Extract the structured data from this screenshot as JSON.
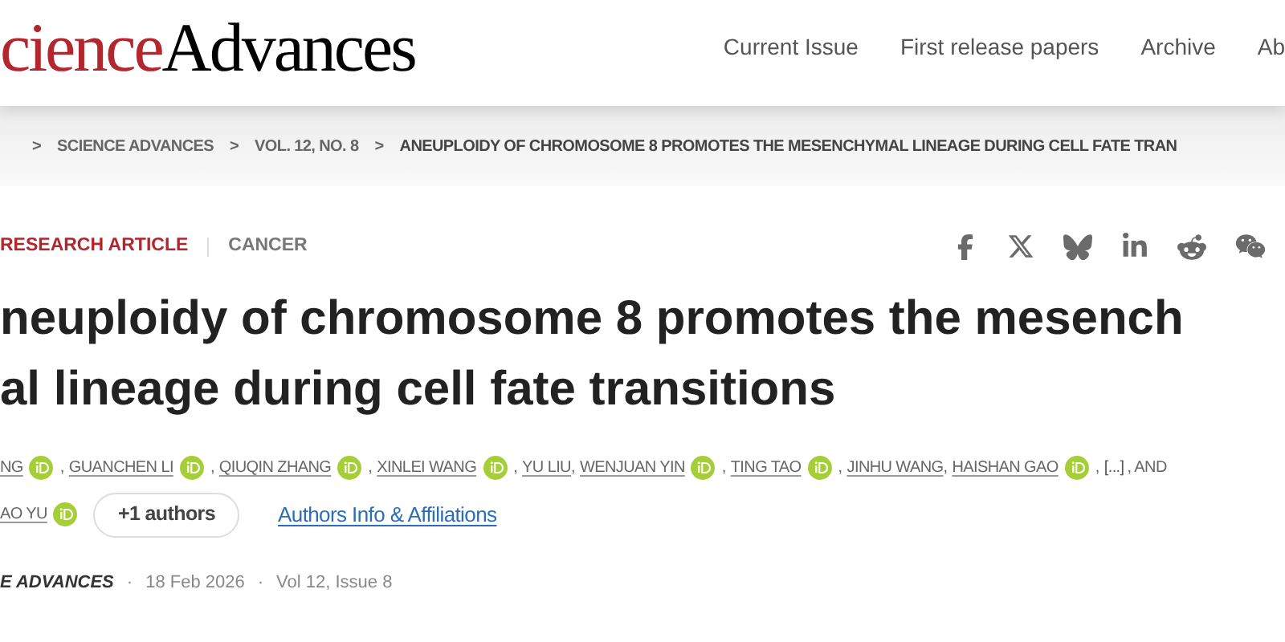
{
  "header": {
    "logo": {
      "part_1": "cience",
      "part_2": "Advances"
    },
    "nav": [
      "Current Issue",
      "First release papers",
      "Archive",
      "Ab"
    ]
  },
  "breadcrumb": {
    "separator": ">",
    "items": [
      "SCIENCE ADVANCES",
      "VOL. 12, NO. 8",
      "ANEUPLOIDY OF CHROMOSOME 8 PROMOTES THE MESENCHYMAL LINEAGE DURING CELL FATE TRAN"
    ]
  },
  "article_type": "RESEARCH ARTICLE",
  "subject": "CANCER",
  "title_lines": [
    "neuploidy of chromosome 8 promotes the mesench",
    "al lineage during cell fate transitions"
  ],
  "author_lines": [
    [
      {
        "kind": "author",
        "name": "NG",
        "orcid": true
      },
      {
        "kind": "text",
        "text": ","
      },
      {
        "kind": "author",
        "name": "GUANCHEN LI",
        "orcid": true
      },
      {
        "kind": "text",
        "text": ","
      },
      {
        "kind": "author",
        "name": "QIUQIN ZHANG",
        "orcid": true
      },
      {
        "kind": "text",
        "text": ","
      },
      {
        "kind": "author",
        "name": "XINLEI WANG",
        "orcid": true
      },
      {
        "kind": "text",
        "text": ","
      },
      {
        "kind": "author",
        "name": "YU LIU",
        "orcid": false
      },
      {
        "kind": "text",
        "text": ","
      },
      {
        "kind": "author",
        "name": "WENJUAN YIN",
        "orcid": true
      },
      {
        "kind": "text",
        "text": ","
      },
      {
        "kind": "author",
        "name": "TING TAO",
        "orcid": true
      },
      {
        "kind": "text",
        "text": ","
      },
      {
        "kind": "author",
        "name": "JINHU WANG",
        "orcid": false
      },
      {
        "kind": "text",
        "text": ","
      },
      {
        "kind": "author",
        "name": "HAISHAN GAO",
        "orcid": true
      },
      {
        "kind": "text",
        "text": ","
      },
      {
        "kind": "more",
        "text": "[...]"
      },
      {
        "kind": "text",
        "text": ", AND"
      }
    ],
    [
      {
        "kind": "author",
        "name": "AO YU",
        "orcid": true
      }
    ]
  ],
  "more_authors_button": "+1 authors",
  "affiliations_link": "Authors Info & Affiliations",
  "meta": {
    "journal": "E ADVANCES",
    "separator": "·",
    "date": "18 Feb 2026",
    "issue": "Vol 12, Issue 8"
  }
}
